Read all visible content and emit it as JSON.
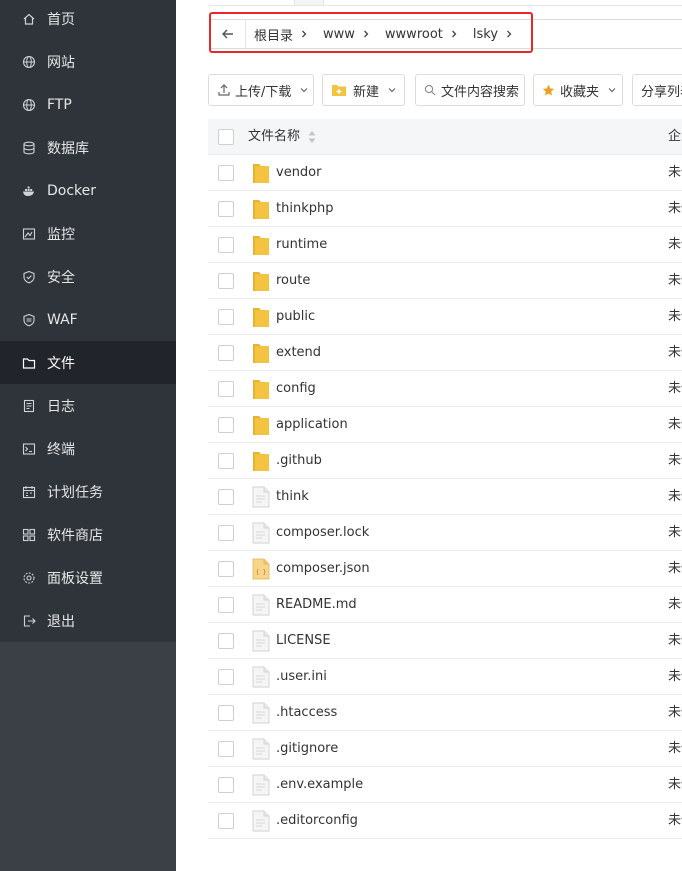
{
  "sidebar": {
    "items": [
      {
        "label": "首页",
        "icon": "home-icon"
      },
      {
        "label": "网站",
        "icon": "globe-icon"
      },
      {
        "label": "FTP",
        "icon": "globe-icon"
      },
      {
        "label": "数据库",
        "icon": "database-icon"
      },
      {
        "label": "Docker",
        "icon": "docker-icon"
      },
      {
        "label": "监控",
        "icon": "monitor-icon"
      },
      {
        "label": "安全",
        "icon": "shield-icon"
      },
      {
        "label": "WAF",
        "icon": "waf-shield-icon"
      },
      {
        "label": "文件",
        "icon": "folder-icon",
        "active": true
      },
      {
        "label": "日志",
        "icon": "log-icon"
      },
      {
        "label": "终端",
        "icon": "terminal-icon"
      },
      {
        "label": "计划任务",
        "icon": "calendar-icon"
      },
      {
        "label": "软件商店",
        "icon": "apps-icon"
      },
      {
        "label": "面板设置",
        "icon": "gear-icon"
      },
      {
        "label": "退出",
        "icon": "logout-icon"
      }
    ]
  },
  "breadcrumb": {
    "segments": [
      "根目录",
      "www",
      "wwwroot",
      "lsky"
    ],
    "highlight_color": "#e8262c"
  },
  "toolbar": {
    "upload_label": "上传/下载",
    "new_label": "新建",
    "search_label": "文件内容搜索",
    "favorites_label": "收藏夹",
    "share_label": "分享列表"
  },
  "table": {
    "header": {
      "name": "文件名称",
      "owner": "企业"
    },
    "rows": [
      {
        "name": "vendor",
        "type": "folder",
        "owner": "未保护"
      },
      {
        "name": "thinkphp",
        "type": "folder",
        "owner": "未保护"
      },
      {
        "name": "runtime",
        "type": "folder",
        "owner": "未保护"
      },
      {
        "name": "route",
        "type": "folder",
        "owner": "未保护"
      },
      {
        "name": "public",
        "type": "folder",
        "owner": "未保护"
      },
      {
        "name": "extend",
        "type": "folder",
        "owner": "未保护"
      },
      {
        "name": "config",
        "type": "folder",
        "owner": "未保护"
      },
      {
        "name": "application",
        "type": "folder",
        "owner": "未保护"
      },
      {
        "name": ".github",
        "type": "folder",
        "owner": "未保护"
      },
      {
        "name": "think",
        "type": "file",
        "owner": "未保护"
      },
      {
        "name": "composer.lock",
        "type": "file",
        "owner": "未保护"
      },
      {
        "name": "composer.json",
        "type": "json",
        "owner": "未保护"
      },
      {
        "name": "README.md",
        "type": "file",
        "owner": "未保护"
      },
      {
        "name": "LICENSE",
        "type": "file",
        "owner": "未保护"
      },
      {
        "name": ".user.ini",
        "type": "file",
        "owner": "未保护"
      },
      {
        "name": ".htaccess",
        "type": "file",
        "owner": "未保护"
      },
      {
        "name": ".gitignore",
        "type": "file",
        "owner": "未保护"
      },
      {
        "name": ".env.example",
        "type": "file",
        "owner": "未保护"
      },
      {
        "name": ".editorconfig",
        "type": "file",
        "owner": "未保护"
      }
    ]
  },
  "colors": {
    "sidebar_bg": "#2f343b",
    "sidebar_active_bg": "#21252b",
    "folder": "#f5c342",
    "favorite_star": "#f0a020"
  }
}
